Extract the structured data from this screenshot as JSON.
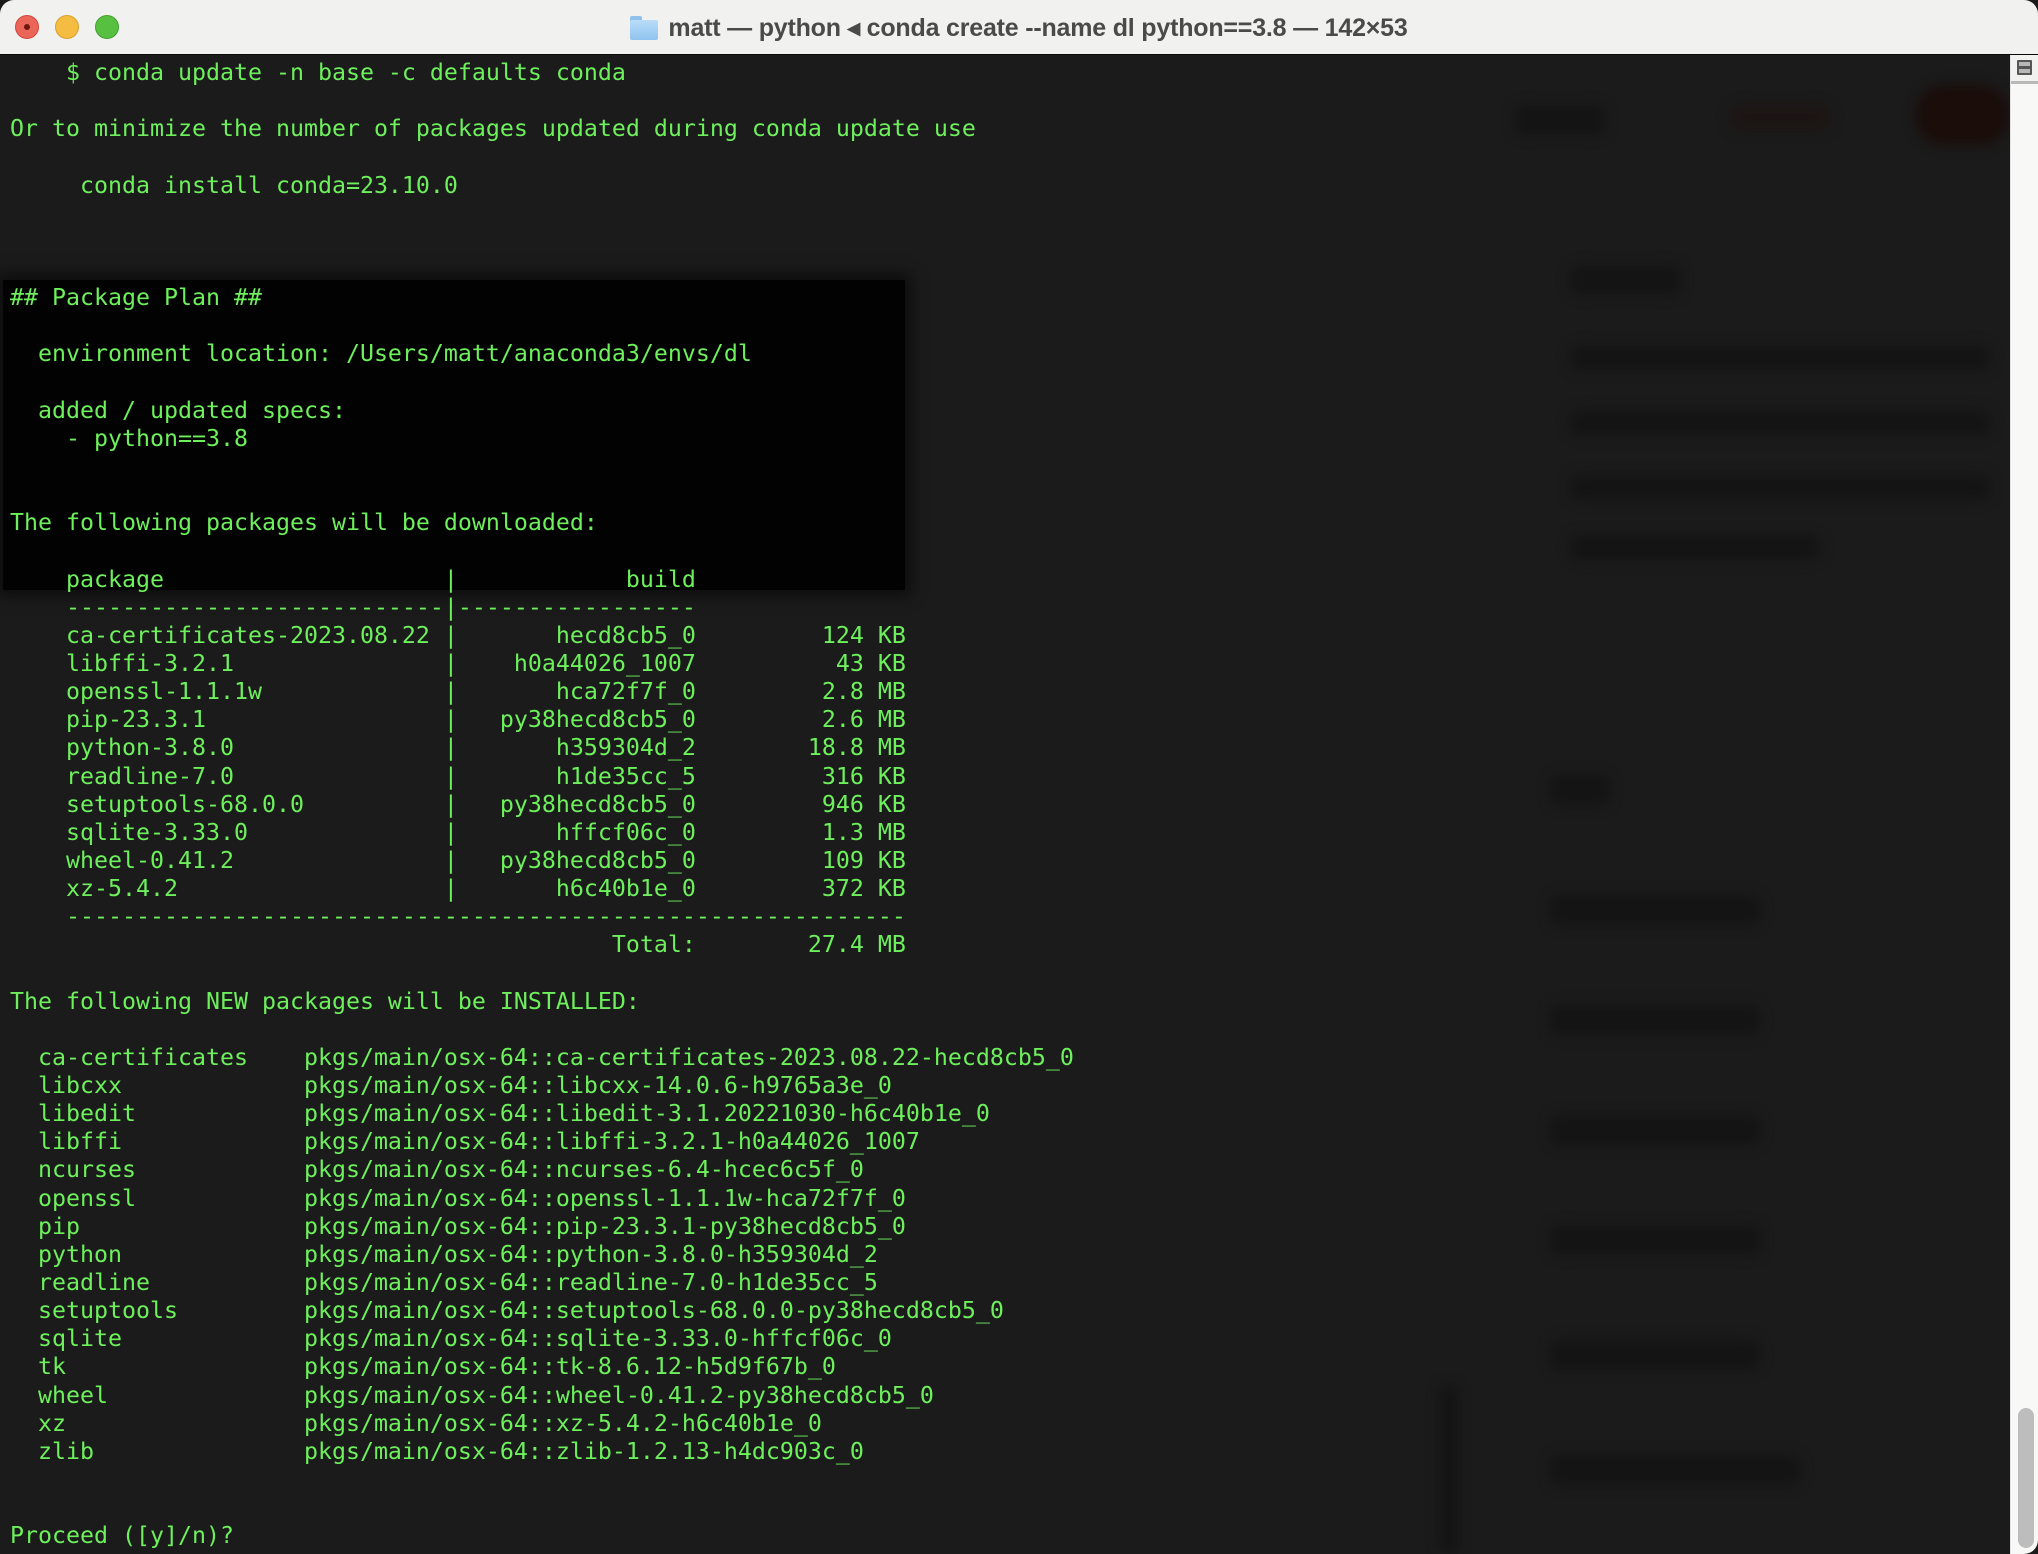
{
  "window": {
    "title": "matt — python ◂ conda create --name dl python==3.8 — 142×53",
    "folder_icon": "folder-icon",
    "controls": [
      "close",
      "minimize",
      "zoom"
    ]
  },
  "terminal": {
    "text_color": "#6df05c",
    "background": "#1b1b1b",
    "lines": [
      "    $ conda update -n base -c defaults conda",
      "",
      "Or to minimize the number of packages updated during conda update use",
      "",
      "     conda install conda=23.10.0",
      "",
      "",
      "",
      "## Package Plan ##",
      "",
      "  environment location: /Users/matt/anaconda3/envs/dl",
      "",
      "  added / updated specs:",
      "    - python==3.8",
      "",
      "",
      "The following packages will be downloaded:",
      "",
      "    package                    |            build",
      "    ---------------------------|-----------------",
      "    ca-certificates-2023.08.22 |       hecd8cb5_0         124 KB",
      "    libffi-3.2.1               |    h0a44026_1007          43 KB",
      "    openssl-1.1.1w             |       hca72f7f_0         2.8 MB",
      "    pip-23.3.1                 |   py38hecd8cb5_0         2.6 MB",
      "    python-3.8.0               |       h359304d_2        18.8 MB",
      "    readline-7.0               |       h1de35cc_5         316 KB",
      "    setuptools-68.0.0          |   py38hecd8cb5_0         946 KB",
      "    sqlite-3.33.0              |       hffcf06c_0         1.3 MB",
      "    wheel-0.41.2               |   py38hecd8cb5_0         109 KB",
      "    xz-5.4.2                   |       h6c40b1e_0         372 KB",
      "    ------------------------------------------------------------",
      "                                           Total:        27.4 MB",
      "",
      "The following NEW packages will be INSTALLED:",
      "",
      "  ca-certificates    pkgs/main/osx-64::ca-certificates-2023.08.22-hecd8cb5_0",
      "  libcxx             pkgs/main/osx-64::libcxx-14.0.6-h9765a3e_0",
      "  libedit            pkgs/main/osx-64::libedit-3.1.20221030-h6c40b1e_0",
      "  libffi             pkgs/main/osx-64::libffi-3.2.1-h0a44026_1007",
      "  ncurses            pkgs/main/osx-64::ncurses-6.4-hcec6c5f_0",
      "  openssl            pkgs/main/osx-64::openssl-1.1.1w-hca72f7f_0",
      "  pip                pkgs/main/osx-64::pip-23.3.1-py38hecd8cb5_0",
      "  python             pkgs/main/osx-64::python-3.8.0-h359304d_2",
      "  readline           pkgs/main/osx-64::readline-7.0-h1de35cc_5",
      "  setuptools         pkgs/main/osx-64::setuptools-68.0.0-py38hecd8cb5_0",
      "  sqlite             pkgs/main/osx-64::sqlite-3.33.0-hffcf06c_0",
      "  tk                 pkgs/main/osx-64::tk-8.6.12-h5d9f67b_0",
      "  wheel              pkgs/main/osx-64::wheel-0.41.2-py38hecd8cb5_0",
      "  xz                 pkgs/main/osx-64::xz-5.4.2-h6c40b1e_0",
      "  zlib               pkgs/main/osx-64::zlib-1.2.13-h4dc903c_0",
      "",
      "",
      "Proceed ([y]/n)?"
    ]
  },
  "scrollbar": {
    "split_button_icon": "split-pane-icon",
    "scroll_position": 1.0
  }
}
